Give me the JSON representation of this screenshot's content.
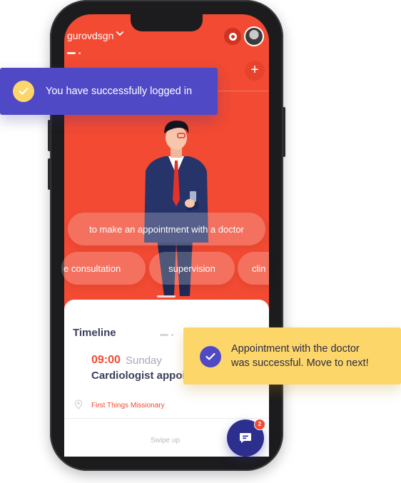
{
  "header": {
    "username": "gurovdsgn",
    "chevron_icon": "chevron-down-icon",
    "record_icon": "record-icon",
    "add_icon": "plus-icon",
    "add_symbol": "+"
  },
  "chips": {
    "row1": [
      "to make an appointment with a doctor"
    ],
    "row2": [
      "e consultation",
      "supervision",
      "clin"
    ]
  },
  "timeline": {
    "title": "Timeline",
    "time": "09:00",
    "day": "Sunday",
    "appointment": "Cardiologist appoi",
    "location_icon": "location-pin-icon",
    "location": "First Things Missionary",
    "swipe_hint": "Swipe up"
  },
  "chat": {
    "icon": "chat-icon",
    "badge_count": "2"
  },
  "notifications": {
    "login": {
      "icon": "check-icon",
      "message": "You have successfully logged in"
    },
    "appointment": {
      "icon": "check-icon",
      "line1": "Appointment with the doctor",
      "line2": "was successful. Move to next!"
    }
  },
  "colors": {
    "brand_red": "#f24a33",
    "accent_purple": "#5049c6",
    "accent_yellow": "#fdd66a",
    "navy": "#2d2f8f",
    "text_dark": "#3b3f5c"
  }
}
